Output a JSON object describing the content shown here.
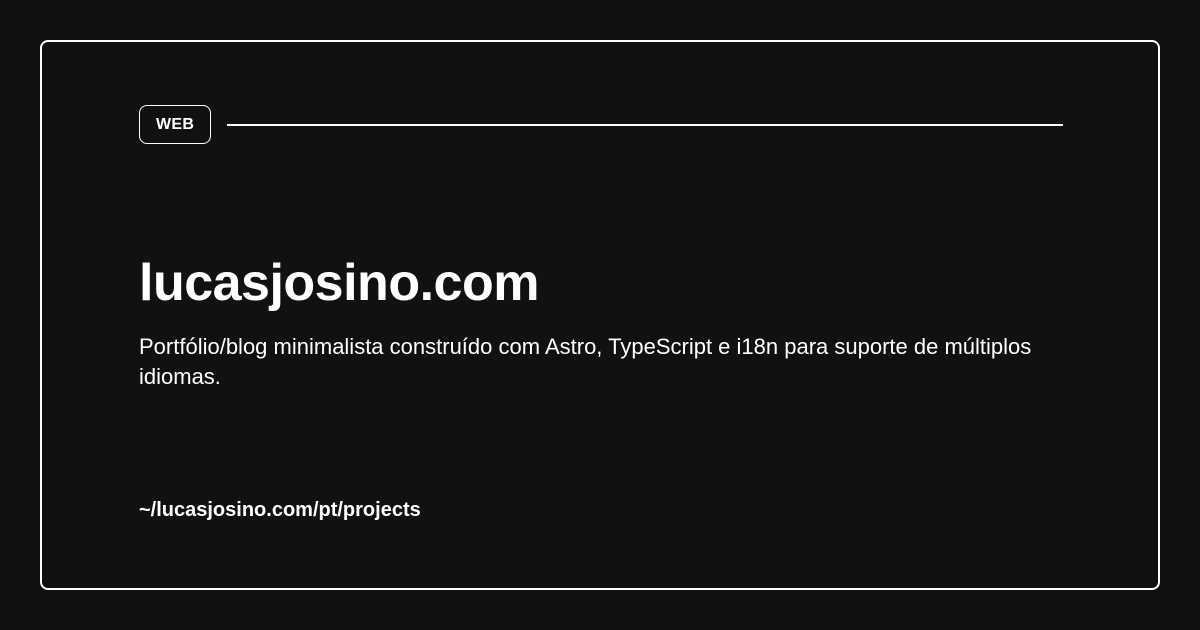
{
  "card": {
    "tag": "WEB",
    "title": "lucasjosino.com",
    "description": "Portfólio/blog minimalista construído com Astro, TypeScript e i18n para suporte de múltiplos idiomas.",
    "path": "~/lucasjosino.com/pt/projects"
  },
  "colors": {
    "background": "#111112",
    "foreground": "#ffffff"
  }
}
